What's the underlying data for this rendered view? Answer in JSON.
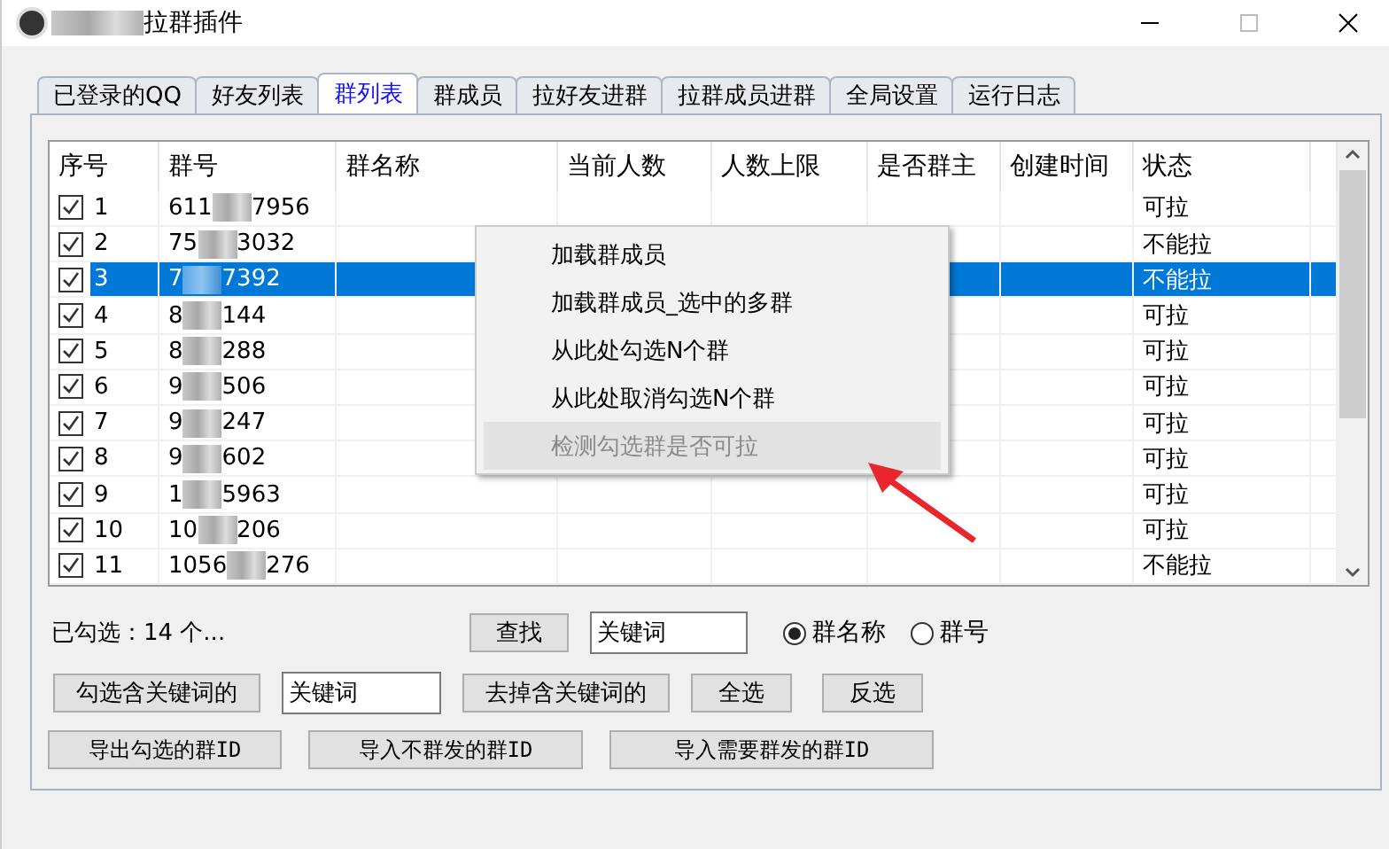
{
  "window": {
    "title": "拉群插件"
  },
  "tabs": [
    {
      "label": "已登录的QQ",
      "selected": false
    },
    {
      "label": "好友列表",
      "selected": false
    },
    {
      "label": "群列表",
      "selected": true
    },
    {
      "label": "群成员",
      "selected": false
    },
    {
      "label": "拉好友进群",
      "selected": false
    },
    {
      "label": "拉群成员进群",
      "selected": false
    },
    {
      "label": "全局设置",
      "selected": false
    },
    {
      "label": "运行日志",
      "selected": false
    }
  ],
  "table": {
    "columns": [
      "序号",
      "群号",
      "群名称",
      "当前人数",
      "人数上限",
      "是否群主",
      "创建时间",
      "状态"
    ],
    "rows": [
      {
        "index": "1",
        "group_start": "611",
        "group_end": "7956",
        "status": "可拉",
        "checked": true,
        "selected": false
      },
      {
        "index": "2",
        "group_start": "75",
        "group_end": "3032",
        "status": "不能拉",
        "checked": true,
        "selected": false
      },
      {
        "index": "3",
        "group_start": "7",
        "group_end": "7392",
        "status": "不能拉",
        "checked": true,
        "selected": true
      },
      {
        "index": "4",
        "group_start": "8",
        "group_end": "144",
        "status": "可拉",
        "checked": true,
        "selected": false
      },
      {
        "index": "5",
        "group_start": "8",
        "group_end": "288",
        "status": "可拉",
        "checked": true,
        "selected": false
      },
      {
        "index": "6",
        "group_start": "9",
        "group_end": "506",
        "status": "可拉",
        "checked": true,
        "selected": false
      },
      {
        "index": "7",
        "group_start": "9",
        "group_end": "247",
        "status": "可拉",
        "checked": true,
        "selected": false
      },
      {
        "index": "8",
        "group_start": "9",
        "group_end": "602",
        "status": "可拉",
        "checked": true,
        "selected": false
      },
      {
        "index": "9",
        "group_start": "1",
        "group_end": "5963",
        "status": "可拉",
        "checked": true,
        "selected": false
      },
      {
        "index": "10",
        "group_start": "10",
        "group_end": "206",
        "status": "可拉",
        "checked": true,
        "selected": false
      },
      {
        "index": "11",
        "group_start": "1056",
        "group_end": "276",
        "status": "不能拉",
        "checked": true,
        "selected": false
      }
    ]
  },
  "context_menu": [
    {
      "label": "加载群成员",
      "disabled": false,
      "selected": false
    },
    {
      "label": "加载群成员_选中的多群",
      "disabled": false,
      "selected": false
    },
    {
      "label": "从此处勾选N个群",
      "disabled": false,
      "selected": false
    },
    {
      "label": "从此处取消勾选N个群",
      "disabled": false,
      "selected": false
    },
    {
      "label": "检测勾选群是否可拉",
      "disabled": true,
      "selected": true
    }
  ],
  "checked_count": "已勾选：14 个...",
  "search": {
    "button": "查找",
    "value": "关键词"
  },
  "search_by": [
    {
      "label": "群名称",
      "selected": true
    },
    {
      "label": "群号",
      "selected": false
    }
  ],
  "filter": {
    "check_button": "勾选含关键词的",
    "value": "关键词",
    "remove_button": "去掉含关键词的",
    "select_all": "全选",
    "invert": "反选"
  },
  "io_buttons": [
    "导出勾选的群ID",
    "导入不群发的群ID",
    "导入需要群发的群ID"
  ]
}
